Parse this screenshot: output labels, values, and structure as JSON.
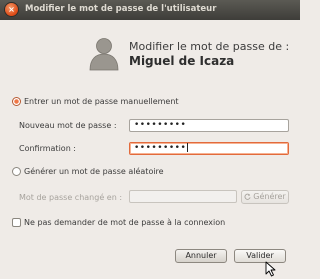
{
  "window": {
    "title": "Modifier le mot de passe de l'utilisateur",
    "close_glyph": "×"
  },
  "header": {
    "line1": "Modifier le mot de passe de :",
    "user_name": "Miguel de Icaza"
  },
  "options": {
    "manual": {
      "label": "Entrer un mot de passe manuellement",
      "selected": true
    },
    "random": {
      "label": "Générer un mot de passe aléatoire",
      "selected": false
    },
    "no_ask": {
      "label": "Ne pas demander de mot de passe à la connexion",
      "checked": false
    }
  },
  "fields": {
    "new_password": {
      "label": "Nouveau mot de passe :",
      "value": "•••••••••"
    },
    "confirmation": {
      "label": "Confirmation :",
      "value": "•••••••••"
    },
    "generated": {
      "label": "Mot de passe changé en :",
      "value": ""
    }
  },
  "buttons": {
    "generate": "Générer",
    "cancel": "Annuler",
    "validate": "Valider"
  },
  "colors": {
    "accent": "#dd4814",
    "titlebar": "#3e3d39",
    "background": "#efebe7"
  },
  "icons": {
    "user_avatar": "user-avatar-icon",
    "generate": "refresh-icon",
    "pointer": "mouse-pointer-icon"
  }
}
